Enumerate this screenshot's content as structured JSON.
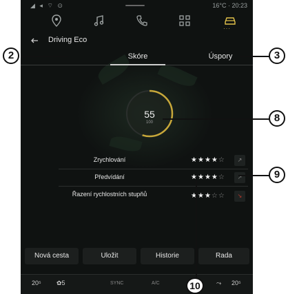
{
  "status": {
    "left_icons": "◢ ◂ ⌔ ⊙",
    "weather": "16°C",
    "time": "20:23",
    "separator": "·"
  },
  "nav": {
    "items": [
      {
        "icon": "location-pin-icon"
      },
      {
        "icon": "music-note-icon"
      },
      {
        "icon": "phone-icon"
      },
      {
        "icon": "apps-grid-icon"
      },
      {
        "icon": "car-icon",
        "active": true
      }
    ],
    "active_color": "#e3c24a"
  },
  "header": {
    "back_icon": "back-arrow-icon",
    "title": "Driving Eco"
  },
  "tabs": {
    "skore": "Skóre",
    "uspory": "Úspory"
  },
  "score": {
    "value": "55",
    "max": "100",
    "fraction": 0.55,
    "arc_color": "#c8a83a"
  },
  "metrics": [
    {
      "label": "Zrychlování",
      "stars": 4,
      "of": 5,
      "trend": "↗",
      "trend_icon": "trend-up-icon"
    },
    {
      "label": "Předvídání",
      "stars": 4,
      "of": 5,
      "trend": "↗",
      "trend_icon": "trend-up-icon"
    },
    {
      "label": "Řazení rychlostních stupňů",
      "stars": 3,
      "of": 5,
      "trend": "↘",
      "trend_icon": "trend-down-icon",
      "trend_color": "#c0392b"
    }
  ],
  "actions": {
    "new_trip": "Nová cesta",
    "save": "Uložit",
    "history": "Historie",
    "advice": "Rada"
  },
  "climate": {
    "left_temp": "20",
    "left_unit": "⁵",
    "fan": "5",
    "sync": "SYNC",
    "ac": "A/C",
    "right_temp": "20",
    "right_unit": "⁵"
  },
  "callouts": {
    "c2": "2",
    "c3": "3",
    "c8": "8",
    "c9": "9",
    "c10": "10"
  }
}
